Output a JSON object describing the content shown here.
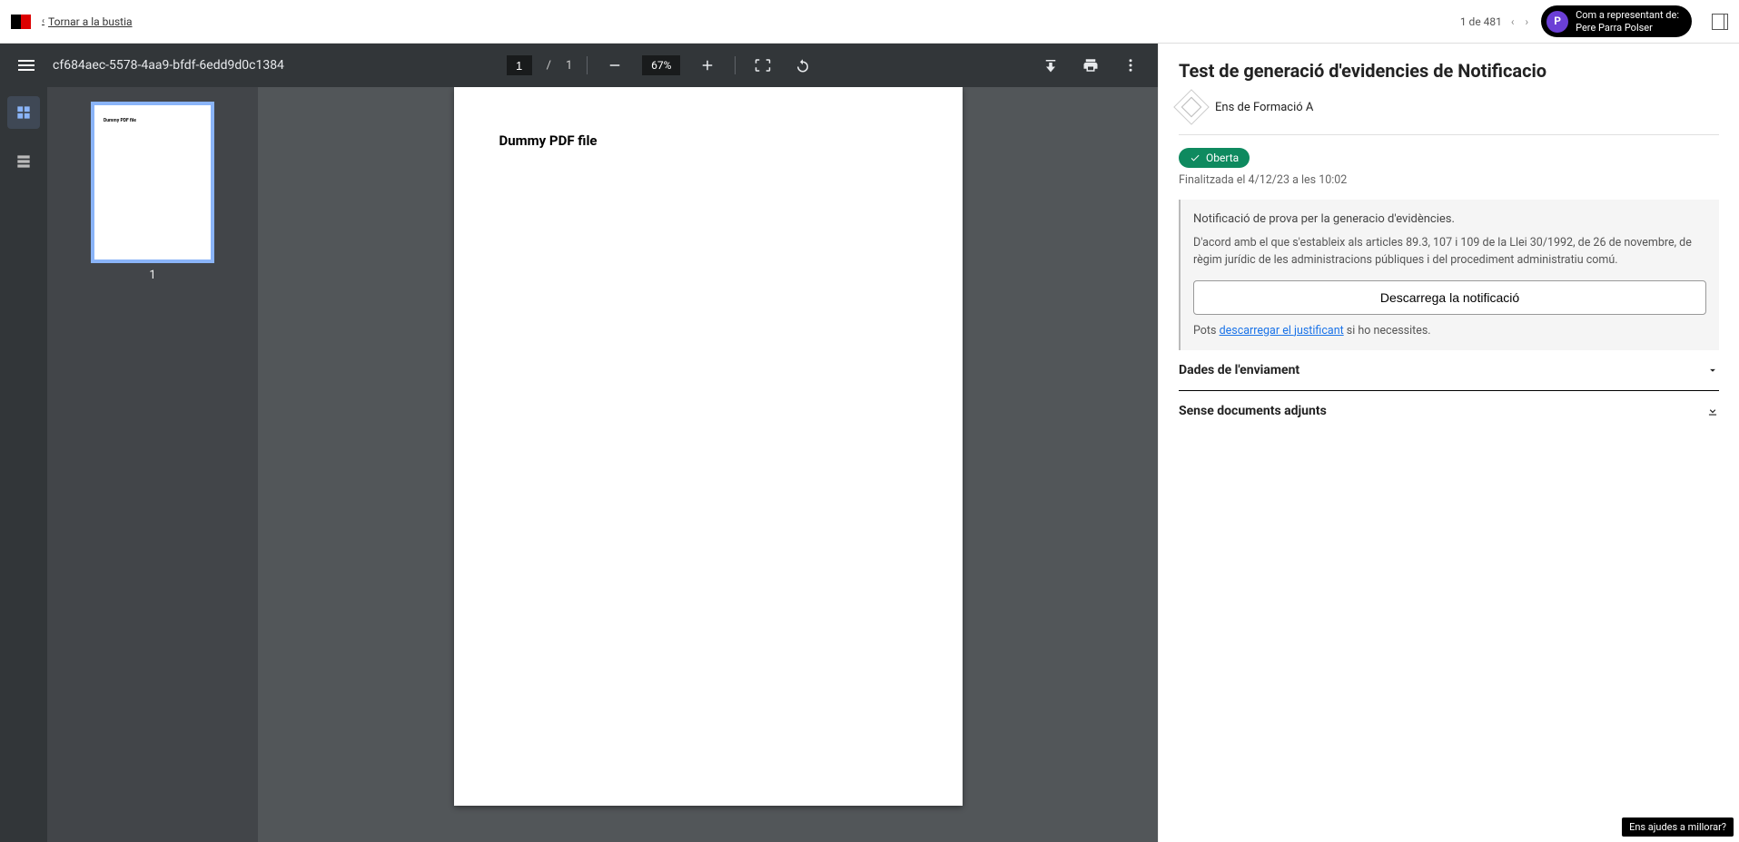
{
  "header": {
    "back_label": "Tornar a la bustia",
    "pager_text": "1 de 481",
    "user": {
      "initial": "P",
      "line1": "Com a representant de:",
      "line2": "Pere Parra Polser"
    }
  },
  "pdf": {
    "filename": "cf684aec-5578-4aa9-bfdf-6edd9d0c1384",
    "page_current": "1",
    "page_total": "1",
    "zoom": "67%",
    "thumb_label": "1",
    "page_text": "Dummy PDF file",
    "thumb_text": "Dummy PDF file"
  },
  "details": {
    "title": "Test de generació d'evidencies de Notificacio",
    "org_name": "Ens de Formació A",
    "badge_label": "Oberta",
    "timestamp": "Finalitzada el 4/12/23 a les 10:02",
    "notice_title": "Notificació de prova per la generacio d'evidències.",
    "notice_body": "D'acord amb el que s'estableix als articles 89.3, 107 i 109 de la Llei 30/1992, de 26 de novembre, de règim jurídic de les administracions públiques i del procediment administratiu comú.",
    "download_label": "Descarrega la notificació",
    "receipt_prefix": "Pots ",
    "receipt_link": "descarregar el justificant",
    "receipt_suffix": " si ho necessites.",
    "section_data": "Dades de l'enviament",
    "section_attachments": "Sense documents adjunts"
  },
  "feedback_label": "Ens ajudes a millorar?"
}
